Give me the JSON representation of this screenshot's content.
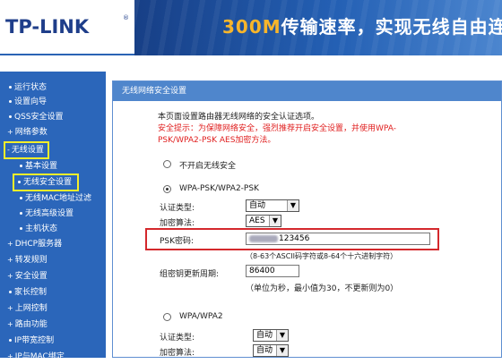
{
  "header": {
    "logo": "TP-LINK",
    "logo_mark": "®",
    "slogan_highlight": "300M",
    "slogan_rest": "传输速率，实现无线自由连"
  },
  "sidebar": {
    "items": [
      {
        "label": "运行状态",
        "marker": "dot"
      },
      {
        "label": "设置向导",
        "marker": "dot"
      },
      {
        "label": "QSS安全设置",
        "marker": "dot"
      },
      {
        "label": "网络参数",
        "marker": "arrow"
      },
      {
        "label": "无线设置",
        "marker": "minus",
        "highlighted": true
      },
      {
        "label": "基本设置",
        "marker": "dot",
        "sub": true
      },
      {
        "label": "无线安全设置",
        "marker": "dot",
        "sub": true,
        "highlighted": true
      },
      {
        "label": "无线MAC地址过滤",
        "marker": "dot",
        "sub": true
      },
      {
        "label": "无线高级设置",
        "marker": "dot",
        "sub": true
      },
      {
        "label": "主机状态",
        "marker": "dot",
        "sub": true
      },
      {
        "label": "DHCP服务器",
        "marker": "arrow"
      },
      {
        "label": "转发规则",
        "marker": "arrow"
      },
      {
        "label": "安全设置",
        "marker": "arrow"
      },
      {
        "label": "家长控制",
        "marker": "dot"
      },
      {
        "label": "上网控制",
        "marker": "arrow"
      },
      {
        "label": "路由功能",
        "marker": "arrow"
      },
      {
        "label": "IP带宽控制",
        "marker": "dot"
      },
      {
        "label": "IP与MAC绑定",
        "marker": "arrow"
      }
    ]
  },
  "panel": {
    "title": "无线网络安全设置",
    "intro": "本页面设置路由器无线网络的安全认证选项。",
    "warning_line1": "安全提示：为保障网络安全，强烈推荐开启安全设置，并使用WPA-",
    "warning_line2": "PSK/WPA2-PSK AES加密方法。",
    "option_none": "不开启无线安全",
    "option_wpa_psk": "WPA-PSK/WPA2-PSK",
    "auth_label": "认证类型:",
    "auth_value": "自动",
    "enc_label": "加密算法:",
    "enc_value": "AES",
    "psk_label": "PSK密码:",
    "psk_value_visible": "123456",
    "psk_hint": "（8-63个ASCII码字符或8-64个十六进制字符）",
    "renew_label": "组密钥更新周期:",
    "renew_value": "86400",
    "renew_hint": "（单位为秒，最小值为30，不更新则为0）",
    "option_wpa": "WPA/WPA2",
    "auth2_label": "认证类型:",
    "auth2_value": "自动",
    "enc2_label": "加密算法:",
    "enc2_value": "自动"
  },
  "colors": {
    "sidebar": "#2b66ba",
    "header": "#1c4f9c",
    "highlight_box": "#f5ee2a",
    "psk_box": "#d4282c",
    "warning_text": "#e02020"
  }
}
